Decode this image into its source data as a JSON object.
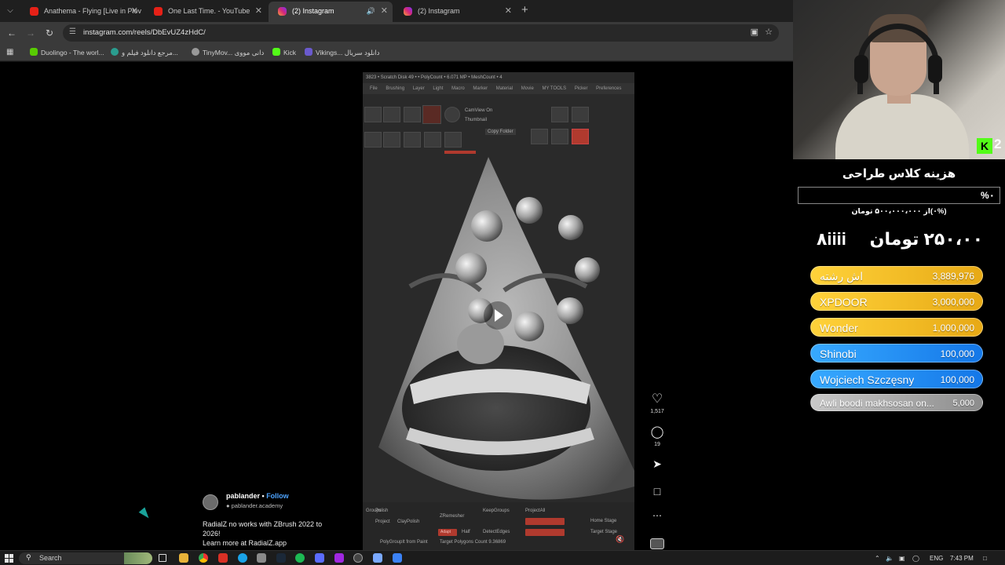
{
  "browser": {
    "tabs": [
      {
        "title": "Anathema - Flying [Live in Plov",
        "favicon": "youtube-icon"
      },
      {
        "title": "One Last Time. - YouTube",
        "favicon": "youtube-icon"
      },
      {
        "title": "(2) Instagram",
        "favicon": "instagram-icon",
        "active": true
      },
      {
        "title": "(2) Instagram",
        "favicon": "instagram-icon"
      }
    ],
    "url": "instagram.com/reels/DbEvUZ4zHdC/",
    "bookmarks": [
      {
        "label": "Duolingo - The worl..."
      },
      {
        "label": "مرجع دانلود فیلم و..."
      },
      {
        "label": "TinyMov... دانی مووی"
      },
      {
        "label": "Kick"
      },
      {
        "label": "Vikings... دانلود سریال"
      }
    ]
  },
  "zbrush": {
    "title": "3823 • Scratch Disk 49 • • PolyCount • 6.071 MP  • MeshCount • 4",
    "menu": [
      "File",
      "Brushing",
      "Layer",
      "Light",
      "Macro",
      "Marker",
      "Material",
      "Movie",
      "MY TOOLS",
      "Picker",
      "Preferences"
    ],
    "camview": "CamView On",
    "thumbnail": "Thumbnail",
    "copy_folder": "Copy Folder",
    "bottom": {
      "groups": "Groups",
      "polish": "Polish",
      "project": "Project",
      "claypolish": "ClayPolish",
      "zremesher": "ZRemesher",
      "keepgroups": "KeepGroups",
      "projectall": "ProjectAll",
      "adapt": "Adapt",
      "half": "Half",
      "detectedges": "DetectEdges",
      "home_stage": "Home Stage",
      "target_stage": "Target Stage",
      "polygroups_from_paint": "PolyGroupIt from Paint",
      "target_polygons": "Target Polygons Count 9.36869"
    }
  },
  "reel": {
    "likes": "1,517",
    "comments": "19",
    "user": "pablander",
    "follow": "Follow",
    "sub": "pablander.academy",
    "caption_line1": "RadialZ no works with ZBrush 2022 to",
    "caption_line2": "2026!",
    "caption_line3": "Learn more at RadialZ.app"
  },
  "overlay": {
    "kick_count": "2",
    "goal_title": "هزینه کلاس طراحی",
    "goal_percent": "%۰",
    "goal_sub": "(۰%)از ۵۰۰،۰۰۰،۰۰۰ تومان",
    "big_amount": "۲۵۰،۰۰ تومان",
    "big_partial": "٨iiii",
    "donors": [
      {
        "name": "اش رشته",
        "amount": "3,889,976",
        "color_from": "#ffd23a",
        "color_to": "#e7a915"
      },
      {
        "name": "XPDOOR",
        "amount": "3,000,000",
        "color_from": "#ffd23a",
        "color_to": "#e7a915"
      },
      {
        "name": "Wonder",
        "amount": "1,000,000",
        "color_from": "#ffd23a",
        "color_to": "#e7a915"
      },
      {
        "name": "Shinobi",
        "amount": "100,000",
        "color_from": "#37a9ff",
        "color_to": "#1477e8"
      },
      {
        "name": "Wojciech Szczęsny",
        "amount": "100,000",
        "color_from": "#37a9ff",
        "color_to": "#1477e8"
      },
      {
        "name": "Awli boodi makhsosan on...",
        "amount": "5,000",
        "color_from": "#c8c8c8",
        "color_to": "#8c8c8c"
      }
    ]
  },
  "taskbar": {
    "search": "Search",
    "lang": "ENG",
    "time": "7:43 PM"
  }
}
